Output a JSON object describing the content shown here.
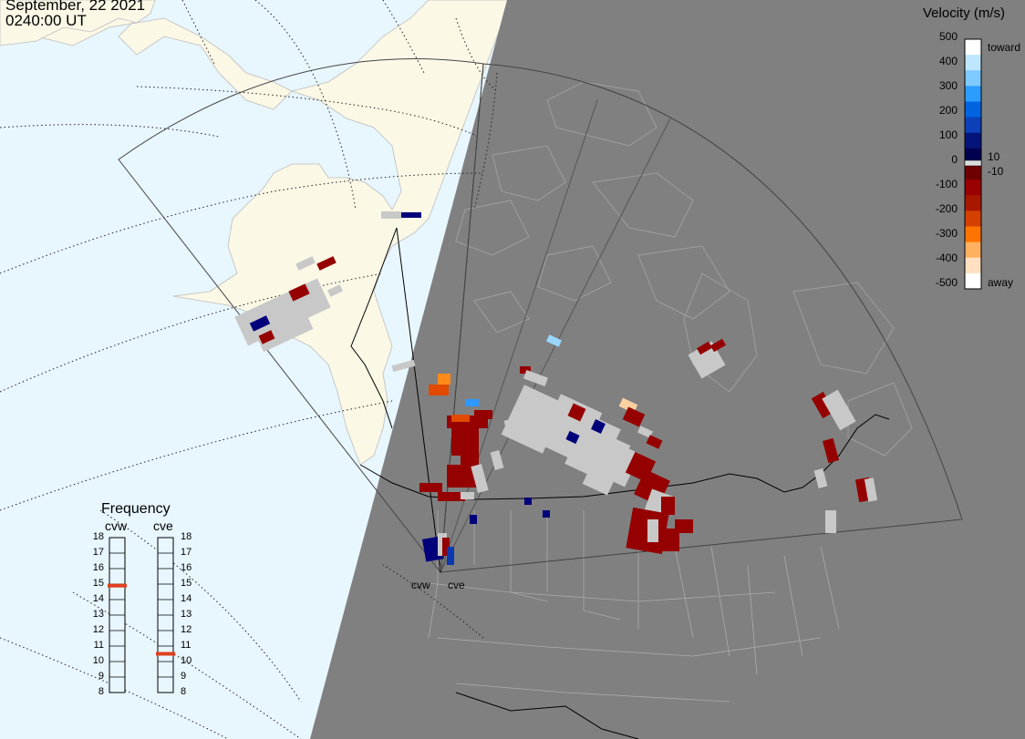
{
  "header": {
    "date": "September, 22 2021",
    "time": "0240:00 UT"
  },
  "colorbar": {
    "title": "Velocity (m/s)",
    "ticks": [
      "500",
      "400",
      "300",
      "200",
      "100",
      "0",
      "-100",
      "-200",
      "-300",
      "-400",
      "-500"
    ],
    "side_labels": [
      "toward",
      "10",
      "-10",
      "away"
    ],
    "colors": [
      "#ffffff",
      "#bfe6ff",
      "#7ec9ff",
      "#2b9dff",
      "#0064e0",
      "#0c3fb8",
      "#05147a",
      "#000050",
      "#6e0000",
      "#9a0000",
      "#a81800",
      "#d44000",
      "#ff7400",
      "#ffb060",
      "#ffe0c0",
      "#ffffff"
    ]
  },
  "radars": [
    {
      "name": "cvw"
    },
    {
      "name": "cve"
    }
  ],
  "frequency": {
    "title": "Frequency",
    "columns": [
      "cvw",
      "cve"
    ],
    "scale": [
      "18",
      "17",
      "16",
      "15",
      "14",
      "13",
      "12",
      "11",
      "10",
      "9",
      "8"
    ],
    "cvw_mhz": 14.9,
    "cve_mhz": 10.5
  },
  "map": {
    "night_color": "#808080",
    "ocean_color": "#e8f6fe",
    "land_day_color": "#fbf8e6",
    "gate_colors": {
      "ground_scatter": "#c8c8c8",
      "away_slow": "#950000",
      "toward_slow": "#00007a",
      "toward_mid": "#0b3ab0",
      "toward_fast": "#2d98ff",
      "toward_max": "#9ad7ff",
      "away_mid": "#e14a00",
      "away_fast": "#ff8a1a",
      "away_max": "#ffd0a0"
    }
  }
}
